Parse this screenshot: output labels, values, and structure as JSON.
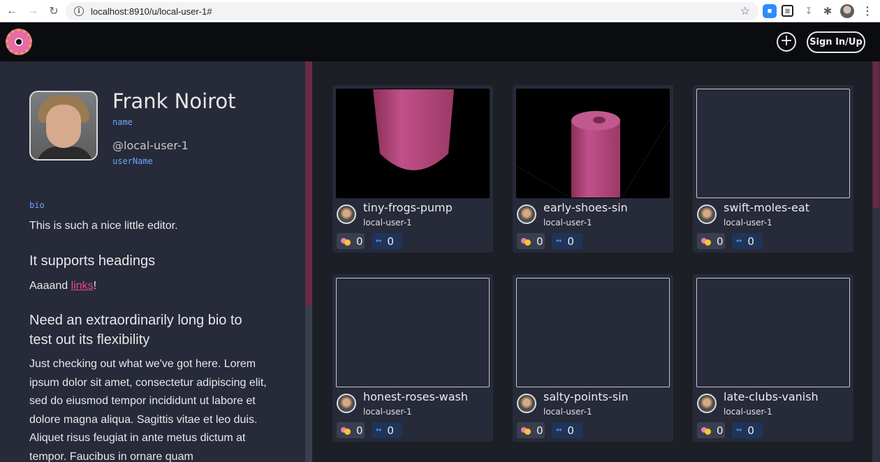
{
  "browser": {
    "url": "localhost:8910/u/local-user-1#"
  },
  "header": {
    "sign_label": "Sign In/Up"
  },
  "profile": {
    "name": "Frank Noirot",
    "name_label": "name",
    "username": "@local-user-1",
    "username_label": "userName",
    "bio_label": "bio",
    "bio_p1": "This is such a nice little editor.",
    "bio_h1": "It supports headings",
    "bio_p2_prefix": "Aaaand ",
    "bio_p2_link": "links",
    "bio_p2_suffix": "!",
    "bio_h2": "Need an extraordinarily long bio to test out its flexibility",
    "bio_p3": "Just checking out what we've got here. Lorem ipsum dolor sit amet, consectetur adipiscing elit, sed do eiusmod tempor incididunt ut labore et dolore magna aliqua. Sagittis vitae et leo duis. Aliquet risus feugiat in ante metus dictum at tempor. Faucibus in ornare quam"
  },
  "projects": [
    {
      "title": "tiny-frogs-pump",
      "user": "local-user-1",
      "likes": "0",
      "forks": "0"
    },
    {
      "title": "early-shoes-sin",
      "user": "local-user-1",
      "likes": "0",
      "forks": "0"
    },
    {
      "title": "swift-moles-eat",
      "user": "local-user-1",
      "likes": "0",
      "forks": "0"
    },
    {
      "title": "honest-roses-wash",
      "user": "local-user-1",
      "likes": "0",
      "forks": "0"
    },
    {
      "title": "salty-points-sin",
      "user": "local-user-1",
      "likes": "0",
      "forks": "0"
    },
    {
      "title": "late-clubs-vanish",
      "user": "local-user-1",
      "likes": "0",
      "forks": "0"
    }
  ],
  "colors": {
    "accent": "#e54b8f",
    "code_label": "#6fa4ff",
    "card_bg": "#262a39",
    "panel_bg": "#262a39"
  }
}
